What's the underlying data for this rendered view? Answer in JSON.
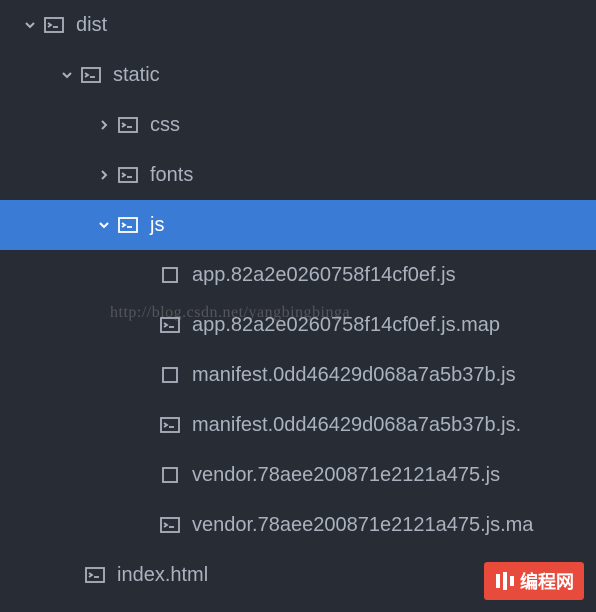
{
  "tree": {
    "dist": "dist",
    "static": "static",
    "css": "css",
    "fonts": "fonts",
    "js": "js",
    "app_js": "app.82a2e0260758f14cf0ef.js",
    "app_js_map": "app.82a2e0260758f14cf0ef.js.map",
    "manifest_js": "manifest.0dd46429d068a7a5b37b.js",
    "manifest_js_map": "manifest.0dd46429d068a7a5b37b.js.",
    "vendor_js": "vendor.78aee200871e2121a475.js",
    "vendor_js_map": "vendor.78aee200871e2121a475.js.ma",
    "index_html": "index.html"
  },
  "watermark": "http://blog.csdn.net/yangbingbinga",
  "badge": "编程网"
}
